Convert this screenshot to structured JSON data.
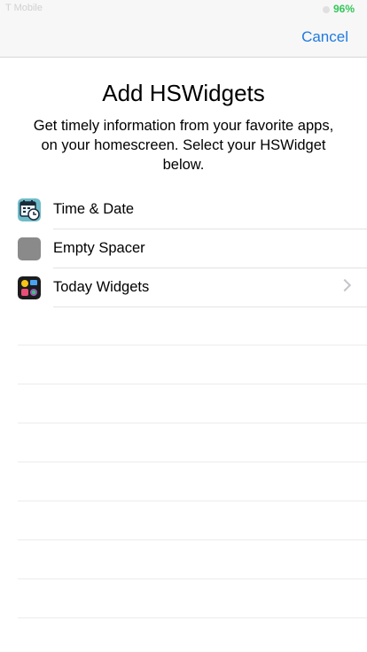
{
  "status_bar": {
    "carrier": "T Mobile",
    "battery": "96%"
  },
  "nav": {
    "cancel_label": "Cancel"
  },
  "header": {
    "title": "Add HSWidgets",
    "description": "Get timely information from your favorite apps, on your homescreen. Select your HSWidget below."
  },
  "list": {
    "items": [
      {
        "label": "Time & Date",
        "icon": "calendar-clock-icon",
        "has_chevron": false
      },
      {
        "label": "Empty Spacer",
        "icon": "gray-square-icon",
        "has_chevron": false
      },
      {
        "label": "Today Widgets",
        "icon": "today-widgets-icon",
        "has_chevron": true
      }
    ]
  },
  "colors": {
    "accent": "#1f7ae0",
    "battery": "#34c759"
  }
}
